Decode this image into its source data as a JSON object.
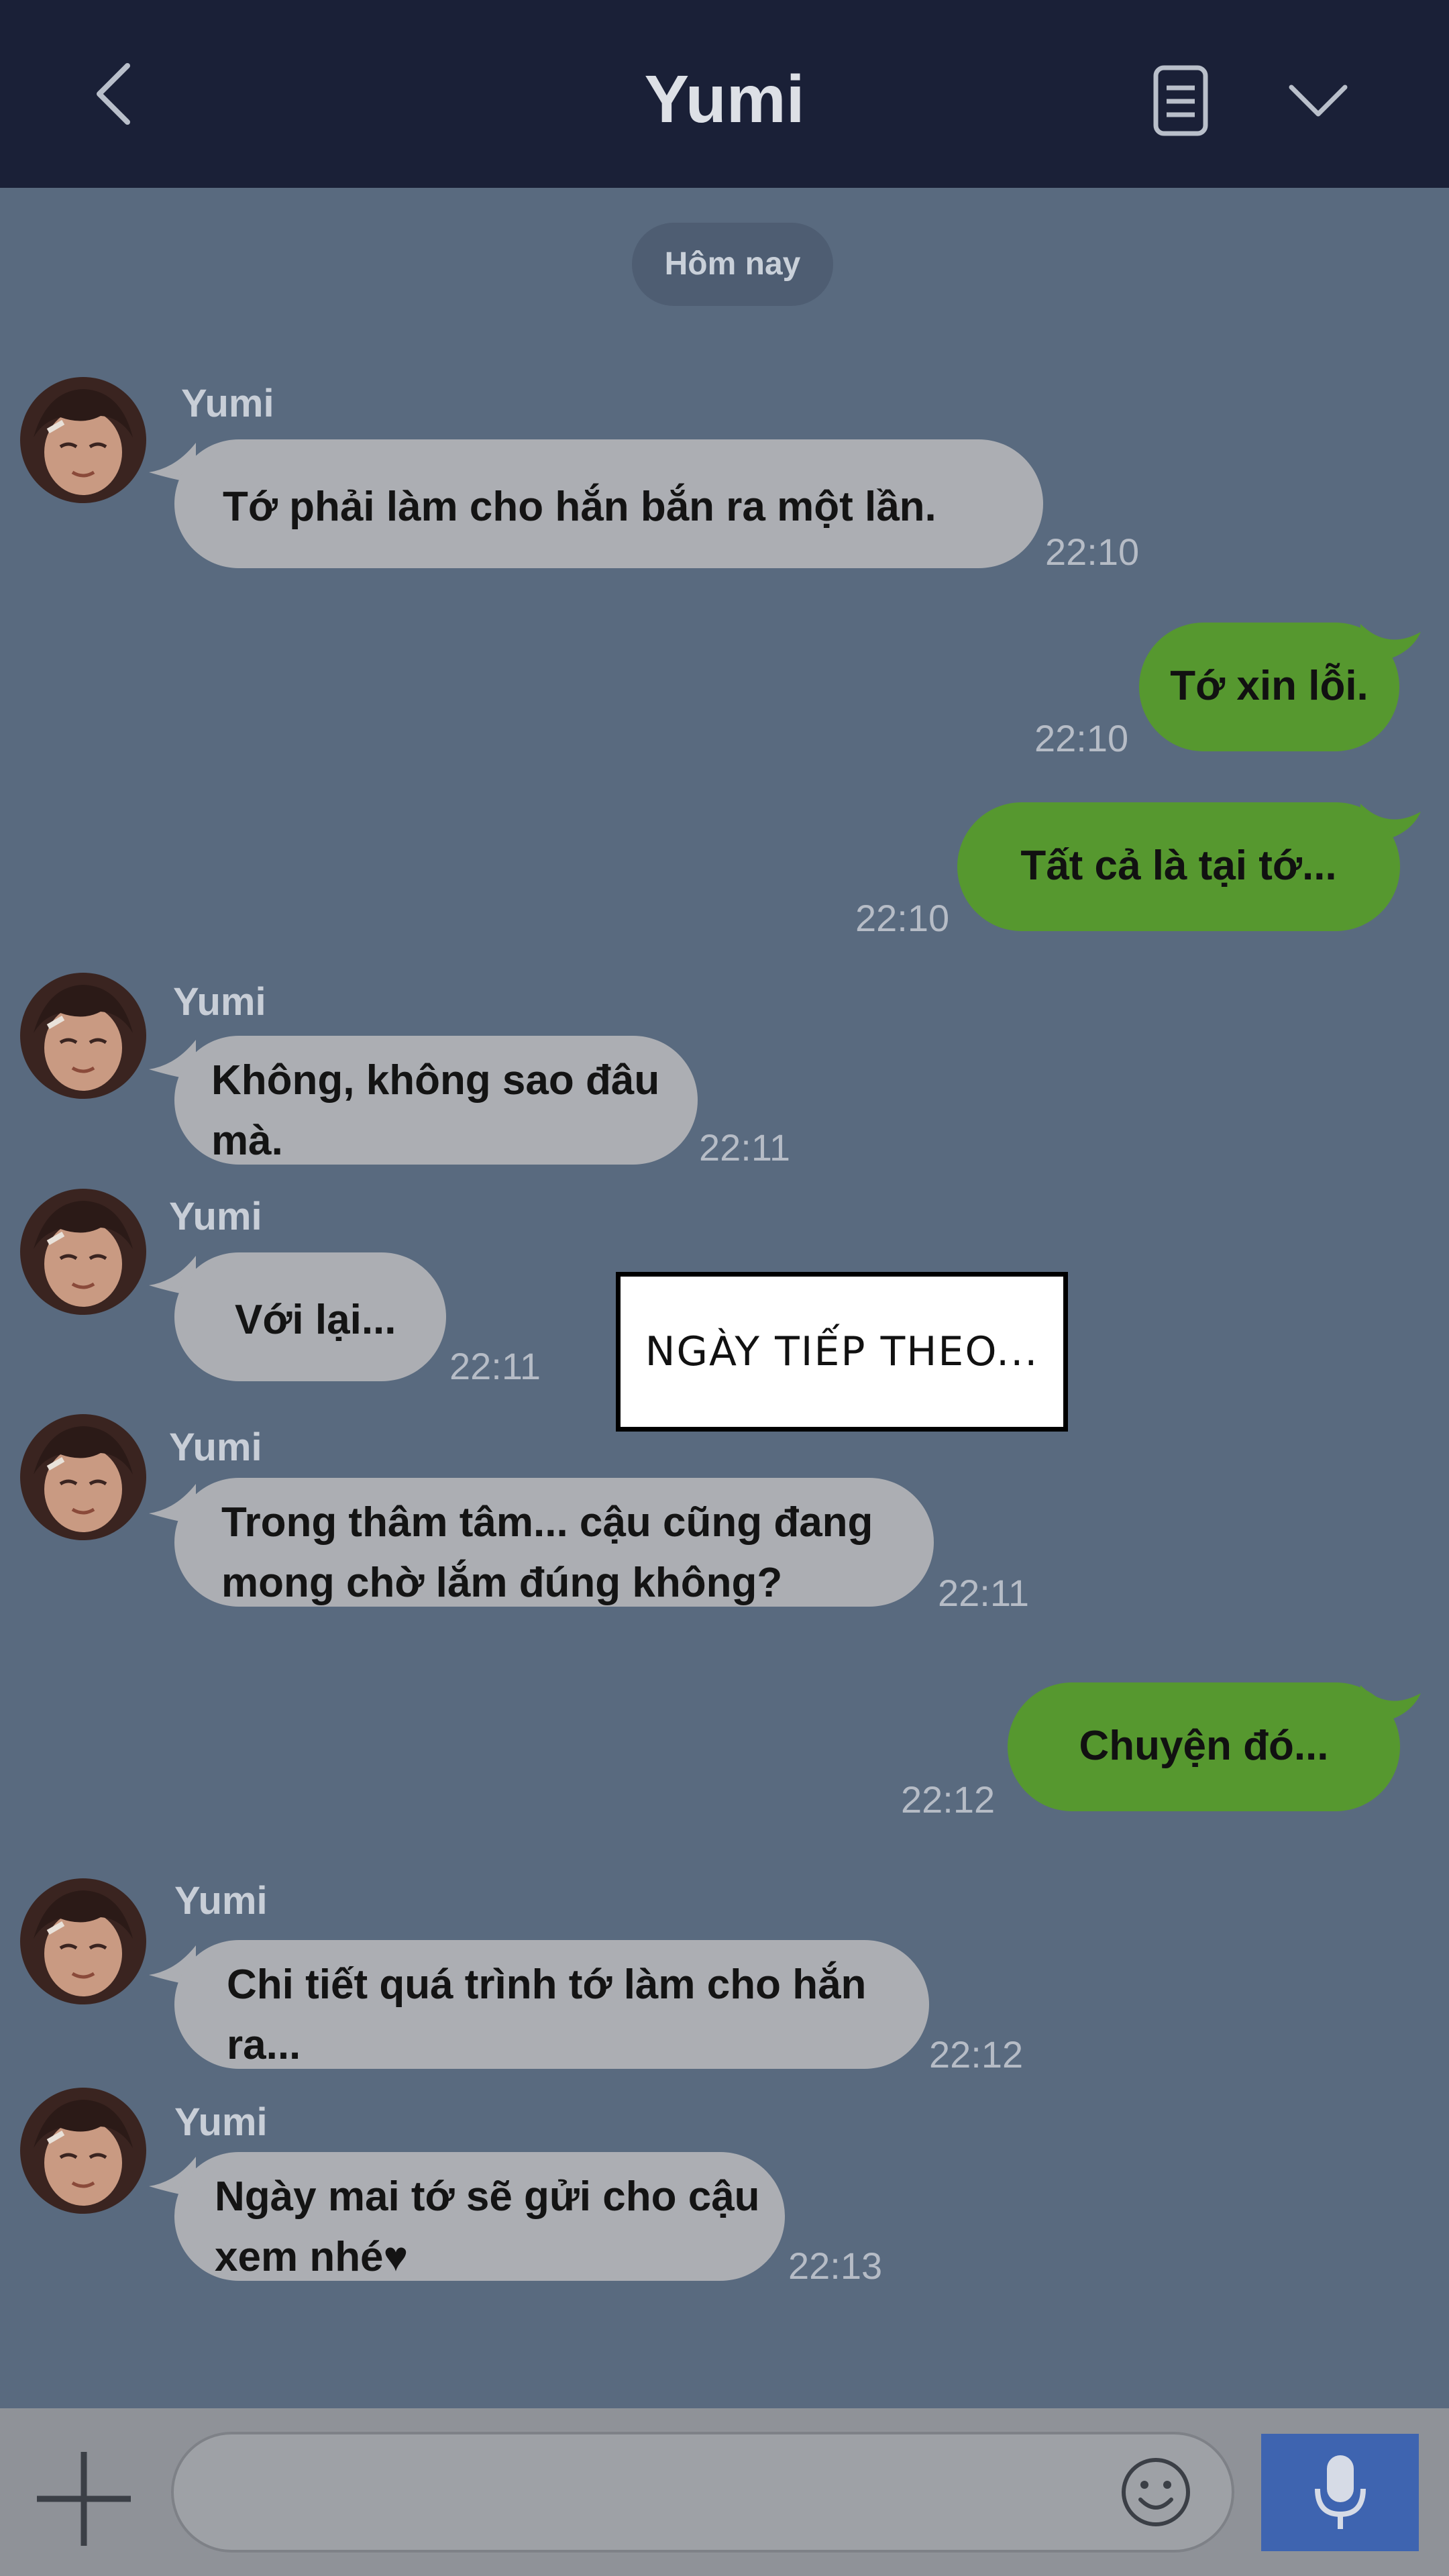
{
  "header": {
    "title": "Yumi",
    "colors": {
      "background": "#1a2037",
      "title": "#dde0e6"
    }
  },
  "date_label": "Hôm nay",
  "messages": [
    {
      "direction": "in",
      "sender": "Yumi",
      "lines": [
        "Tớ phải làm cho hắn bắn ra một lần."
      ],
      "time": "22:10"
    },
    {
      "direction": "out",
      "lines": [
        "Tớ xin lỗi."
      ],
      "time": "22:10"
    },
    {
      "direction": "out",
      "lines": [
        "Tất cả là tại tớ..."
      ],
      "time": "22:10"
    },
    {
      "direction": "in",
      "sender": "Yumi",
      "lines": [
        "Không, không sao đâu",
        "mà."
      ],
      "time": "22:11"
    },
    {
      "direction": "in",
      "sender": "Yumi",
      "lines": [
        "Với lại..."
      ],
      "time": "22:11"
    },
    {
      "direction": "in",
      "sender": "Yumi",
      "lines": [
        "Trong thâm tâm... cậu cũng đang",
        "mong chờ lắm đúng không?"
      ],
      "time": "22:11"
    },
    {
      "direction": "out",
      "lines": [
        "Chuyện đó..."
      ],
      "time": "22:12"
    },
    {
      "direction": "in",
      "sender": "Yumi",
      "lines": [
        "Chi tiết quá trình tớ làm cho hắn",
        "ra..."
      ],
      "time": "22:12"
    },
    {
      "direction": "in",
      "sender": "Yumi",
      "lines": [
        "Ngày mai tớ sẽ gửi cho cậu",
        "xem nhé♥"
      ],
      "time": "22:13"
    }
  ],
  "caption": "NGÀY TIẾP THEO...",
  "colors": {
    "chat_background": "#596a7f",
    "incoming_bubble": "#acaeb3",
    "outgoing_bubble": "#56982f",
    "mic_button": "#3e64b0"
  },
  "icons": [
    "back-arrow-icon",
    "notes-icon",
    "chevron-down-icon",
    "plus-icon",
    "emoji-icon",
    "microphone-icon"
  ]
}
